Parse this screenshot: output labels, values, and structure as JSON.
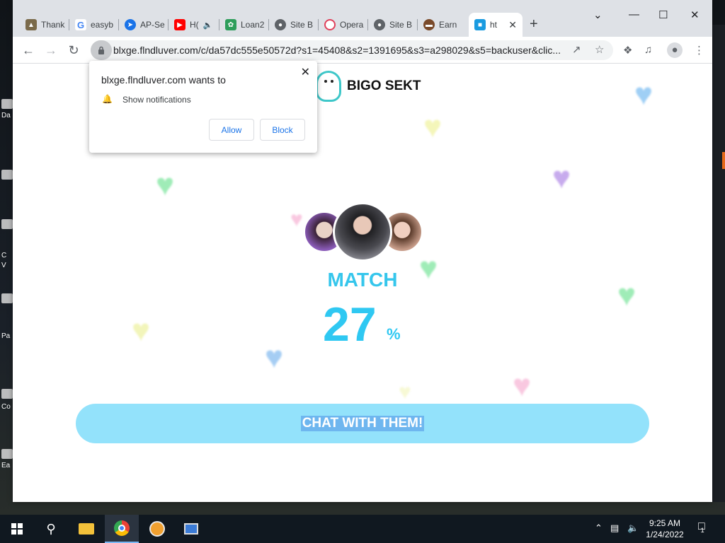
{
  "browser": {
    "tabs": [
      {
        "label": "Thank",
        "icon": "shirt-icon",
        "color": "#7a6a4a"
      },
      {
        "label": "easyb",
        "icon": "google-icon",
        "color": "#4285f4"
      },
      {
        "label": "AP-Se",
        "icon": "ap-icon",
        "color": "#1a73e8"
      },
      {
        "label": "H(",
        "icon": "youtube-icon",
        "color": "#ff0000"
      },
      {
        "label": "Loan2",
        "icon": "palm-icon",
        "color": "#2e9e5b"
      },
      {
        "label": "Site B",
        "icon": "globe-icon",
        "color": "#5f6368"
      },
      {
        "label": "Opera",
        "icon": "opera-icon",
        "color": "#e0405a"
      },
      {
        "label": "Site B",
        "icon": "globe-icon",
        "color": "#5f6368"
      },
      {
        "label": "Earn",
        "icon": "coin-icon",
        "color": "#7a4a2a"
      },
      {
        "label": "ht",
        "icon": "site-icon",
        "color": "#1a9be0",
        "active": true
      }
    ],
    "url": "blxge.flndluver.com/c/da57dc555e50572d?s1=45408&s2=1391695&s3=a298029&s5=backuser&clic..."
  },
  "notification_prompt": {
    "title": "blxge.flndluver.com wants to",
    "permission": "Show notifications",
    "allow_label": "Allow",
    "block_label": "Block"
  },
  "page": {
    "brand": "BIGO SEKT",
    "match_label": "MATCH",
    "match_percent": "27",
    "percent_sign": "%",
    "cta_label": "CHAT WITH THEM!",
    "colors": {
      "accent": "#35c6ec",
      "cta_bg": "#93e2fb"
    }
  },
  "desktop": {
    "labels": [
      "Da",
      "C",
      "V",
      "Pa",
      "Co",
      "Ea"
    ]
  },
  "taskbar": {
    "time": "9:25 AM",
    "date": "1/24/2022",
    "notification_count": "1"
  }
}
